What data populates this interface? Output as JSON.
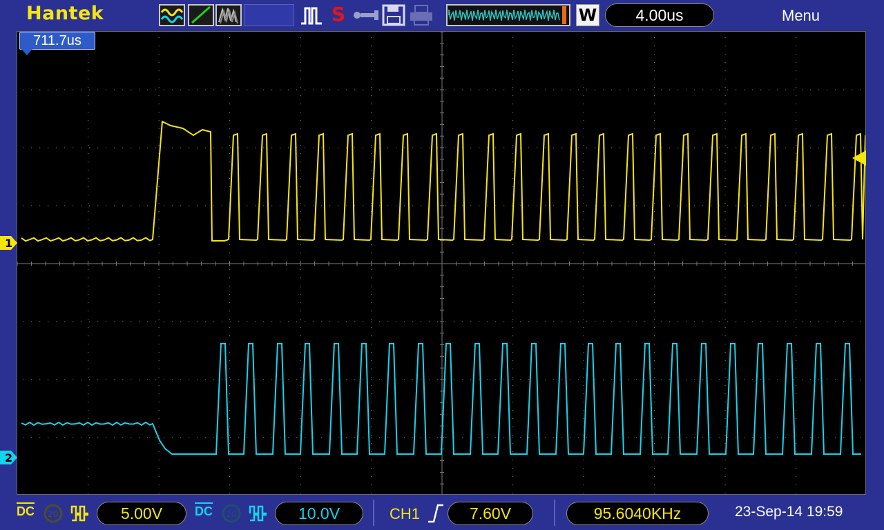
{
  "header": {
    "brand": "Hantek",
    "timebase": "4.00us",
    "menu_label": "Menu",
    "timebase_mode": "W",
    "run_state": "S"
  },
  "trigger_time": "711.7us",
  "channels": {
    "ch1": {
      "marker": "1",
      "scale": "5.00V",
      "coupling": "DC",
      "color": "#f6e60e"
    },
    "ch2": {
      "marker": "2",
      "scale": "10.0V",
      "coupling": "DC",
      "color": "#14d4ee"
    }
  },
  "trigger": {
    "source": "CH1",
    "level": "7.60V"
  },
  "frequency": "95.6040KHz",
  "datetime": "23-Sep-14 19:59",
  "colors": {
    "background": "#2a3192",
    "screen": "#000000",
    "ch1": "#f6e60e",
    "ch2": "#14d4ee",
    "highlight": "#2f5bc9"
  },
  "icons": [
    "waveform-icon",
    "line-icon",
    "persistence-icon",
    "pulse-icon",
    "usb-icon",
    "save-icon",
    "print-icon",
    "horizontal-position-icon",
    "rising-edge-icon",
    "bandwidth-limit-icon",
    "invert-icon"
  ]
}
